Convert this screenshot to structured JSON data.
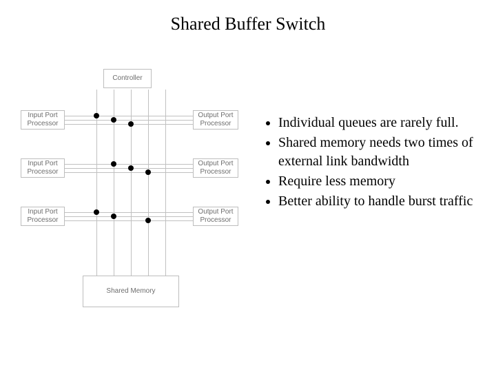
{
  "title": "Shared Buffer Switch",
  "diagram": {
    "controller": "Controller",
    "input_ports": [
      "Input Port\nProcessor",
      "Input Port\nProcessor",
      "Input Port\nProcessor"
    ],
    "output_ports": [
      "Output Port\nProcessor",
      "Output Port\nProcessor",
      "Output Port\nProcessor"
    ],
    "shared_memory": "Shared Memory"
  },
  "bullets": [
    "Individual queues are rarely full.",
    "Shared memory needs two times of external link bandwidth",
    "Require less memory",
    "Better ability to handle burst traffic"
  ]
}
